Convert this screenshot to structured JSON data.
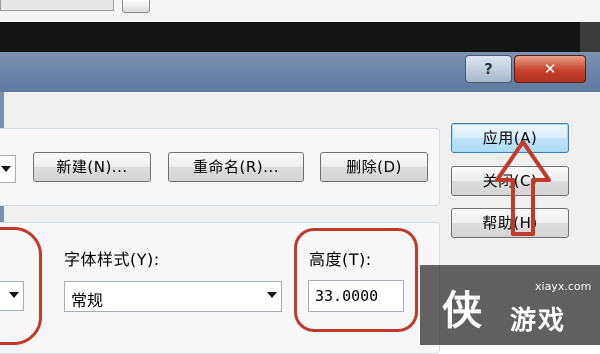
{
  "dialog": {
    "help_glyph": "?",
    "close_glyph": "✕"
  },
  "style_row": {
    "new_button": "新建(N)...",
    "rename_button": "重命名(R)...",
    "delete_button": "删除(D)"
  },
  "side_buttons": {
    "apply": "应用(A)",
    "close": "关闭(C)",
    "help": "帮助(H)"
  },
  "font": {
    "style_label": "字体样式(Y):",
    "style_value": "常规",
    "height_label": "高度(T):",
    "height_value": "33.0000"
  },
  "watermark": {
    "logo": "侠",
    "url": "xiayx.com",
    "name": "游戏"
  },
  "colors": {
    "annotation_red": "#c0392b",
    "titlebar": "#6d85a8"
  }
}
